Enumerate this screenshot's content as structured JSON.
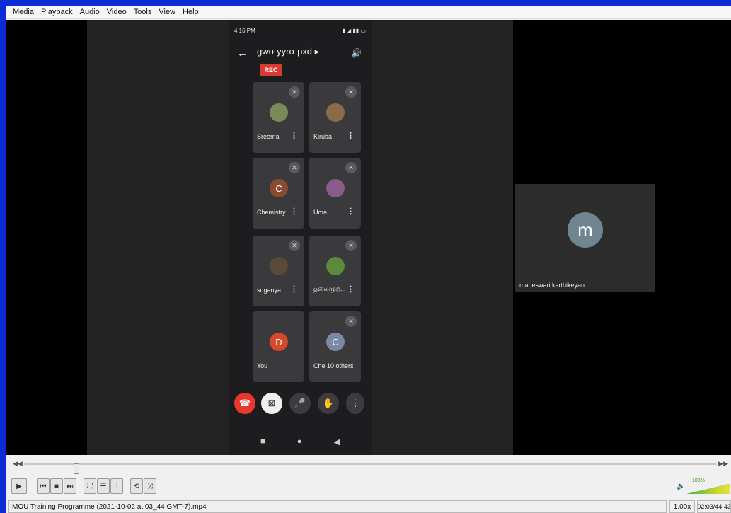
{
  "menu": [
    "Media",
    "Playback",
    "Audio",
    "Video",
    "Tools",
    "View",
    "Help"
  ],
  "phone": {
    "status_time": "4:16 PM",
    "meeting_code": "gwo-yyro-pxd ▸",
    "rec_label": "REC",
    "participants": [
      {
        "name": "Sreema",
        "avatar_color": "#7a8a5a",
        "initial": ""
      },
      {
        "name": "Kiruba",
        "avatar_color": "#8a6a4a",
        "initial": ""
      },
      {
        "name": "Chemistry",
        "avatar_color": "#8a4a32",
        "initial": "C"
      },
      {
        "name": "Uma",
        "avatar_color": "#8a5a8a",
        "initial": ""
      },
      {
        "name": "suganya",
        "avatar_color": "#5a4a3a",
        "initial": ""
      },
      {
        "name": "தலைமுற...",
        "avatar_color": "#5a8a3a",
        "initial": ""
      },
      {
        "name": "You",
        "avatar_color": "#d44a2a",
        "initial": "D"
      },
      {
        "name": "Che  10 others",
        "avatar_color": "#7a8aa4",
        "initial": "C"
      }
    ]
  },
  "remote": {
    "initial": "m",
    "name": "maheswari karthikeyan"
  },
  "player": {
    "volume_pct": "100%",
    "filename": "MOU Training Programme (2021-10-02 at 03_44 GMT-7).mp4",
    "speed": "1.00x",
    "time": "02:03/44:43"
  },
  "colors": {
    "border": "#0a2bd6",
    "rec": "#d63b34",
    "end_call": "#e8382e"
  }
}
